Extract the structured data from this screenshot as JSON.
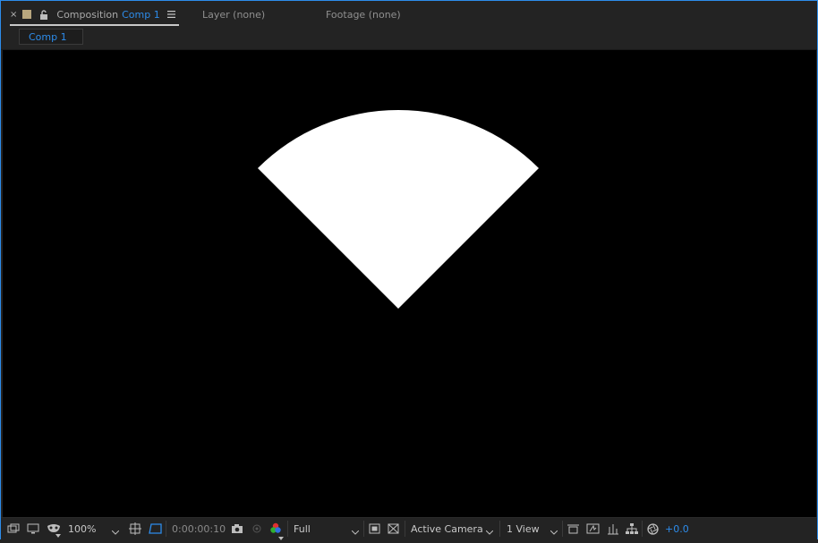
{
  "panel": {
    "close_glyph": "×",
    "tab_label": "Composition",
    "tab_comp_name": "Comp 1",
    "layer_tab": "Layer  (none)",
    "footage_tab": "Footage  (none)",
    "breadcrumb": "Comp 1"
  },
  "viewer": {
    "background": "#000000",
    "shape_color": "#ffffff",
    "shape": "wedge-sector"
  },
  "toolbar": {
    "zoom": "100%",
    "timecode": "0:00:00:10",
    "resolution": "Full",
    "camera": "Active Camera",
    "views": "1 View",
    "exposure": "+0.0",
    "icons": [
      "always-preview-icon",
      "monitor-icon",
      "mask-visibility-icon",
      "safe-zones-icon",
      "region-of-interest-icon",
      "snapshot-icon",
      "show-snapshot-icon",
      "color-channels-icon",
      "fast-preview-icon",
      "transparency-grid-icon",
      "3d-renderer-icon",
      "draft-3d-icon",
      "flowchart-icon",
      "reset-exposure-icon"
    ]
  },
  "colors": {
    "accent": "#2d8ceb",
    "panel_bg": "#232323",
    "text": "#a9a9a9"
  }
}
